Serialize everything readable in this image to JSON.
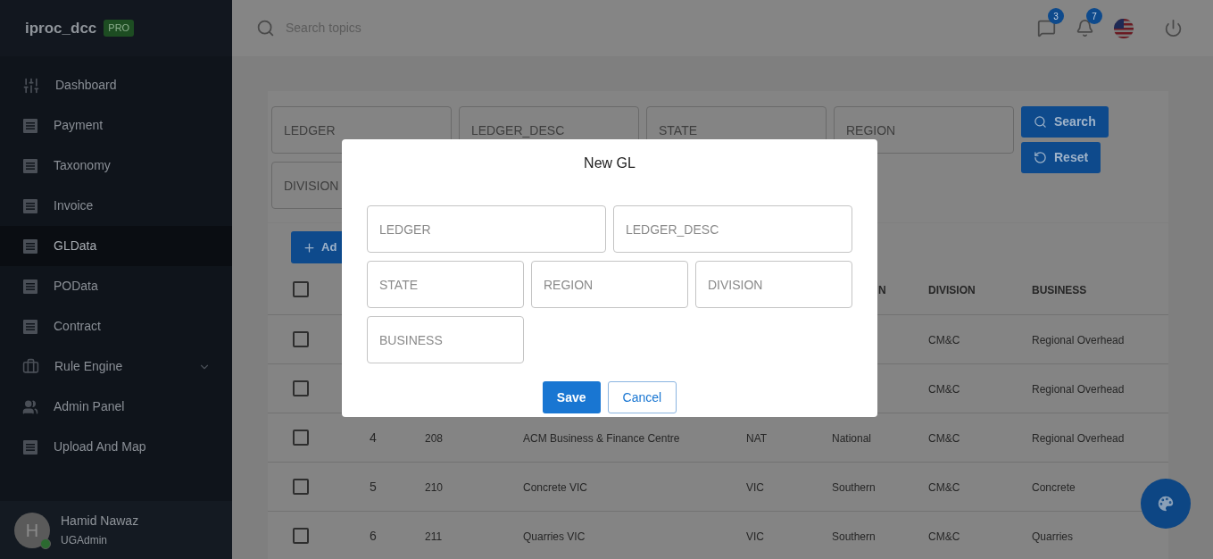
{
  "app": {
    "name": "iproc_dcc",
    "badge": "PRO"
  },
  "sidebar": {
    "items": [
      {
        "label": "Dashboard",
        "kind": "sliders",
        "selected": false
      },
      {
        "label": "Payment",
        "kind": "page",
        "selected": false
      },
      {
        "label": "Taxonomy",
        "kind": "page",
        "selected": false
      },
      {
        "label": "Invoice",
        "kind": "page",
        "selected": false
      },
      {
        "label": "GLData",
        "kind": "page",
        "selected": true
      },
      {
        "label": "POData",
        "kind": "page",
        "selected": false
      },
      {
        "label": "Contract",
        "kind": "page",
        "selected": false
      },
      {
        "label": "Rule Engine",
        "kind": "group",
        "selected": false,
        "expandable": true
      },
      {
        "label": "Admin Panel",
        "kind": "people",
        "selected": false
      },
      {
        "label": "Upload And Map",
        "kind": "page",
        "selected": false
      }
    ]
  },
  "user": {
    "initial": "H",
    "name": "Hamid Nawaz",
    "role": "UGAdmin",
    "online": true
  },
  "topbar": {
    "search_placeholder": "Search topics",
    "messages_count": "3",
    "notifications_count": "7"
  },
  "filters": {
    "fields": [
      {
        "placeholder": "LEDGER"
      },
      {
        "placeholder": "LEDGER_DESC"
      },
      {
        "placeholder": "STATE"
      },
      {
        "placeholder": "REGION"
      },
      {
        "placeholder": "DIVISION"
      }
    ],
    "buttons": [
      {
        "label": "Search",
        "kind": "search"
      },
      {
        "label": "Reset",
        "kind": "reset"
      }
    ]
  },
  "table": {
    "add_button": "Ad",
    "header": {
      "checked": false,
      "region": "N",
      "division": "DIVISION",
      "business": "BUSINESS"
    },
    "rows": [
      {
        "checked": false,
        "division": "CM&C",
        "business": "Regional Overhead"
      },
      {
        "checked": false,
        "division": "CM&C",
        "business": "Regional Overhead"
      },
      {
        "checked": false,
        "no": "4",
        "ledger": "208",
        "desc": "ACM Business & Finance Centre",
        "state": "NAT",
        "region": "National",
        "division": "CM&C",
        "business": "Regional Overhead"
      },
      {
        "checked": false,
        "no": "5",
        "ledger": "210",
        "desc": "Concrete VIC",
        "state": "VIC",
        "region": "Southern",
        "division": "CM&C",
        "business": "Concrete"
      },
      {
        "checked": false,
        "no": "6",
        "ledger": "211",
        "desc": "Quarries VIC",
        "state": "VIC",
        "region": "Southern",
        "division": "CM&C",
        "business": "Quarries"
      }
    ]
  },
  "modal": {
    "title": "New GL",
    "field_rows": [
      [
        {
          "placeholder": "LEDGER"
        },
        {
          "placeholder": "LEDGER_DESC"
        }
      ],
      [
        {
          "placeholder": "STATE"
        },
        {
          "placeholder": "REGION"
        },
        {
          "placeholder": "DIVISION"
        }
      ],
      [
        {
          "placeholder": "BUSINESS"
        }
      ]
    ],
    "buttons": [
      {
        "label": "Save",
        "kind": "primary"
      },
      {
        "label": "Cancel",
        "kind": "outline"
      }
    ]
  }
}
